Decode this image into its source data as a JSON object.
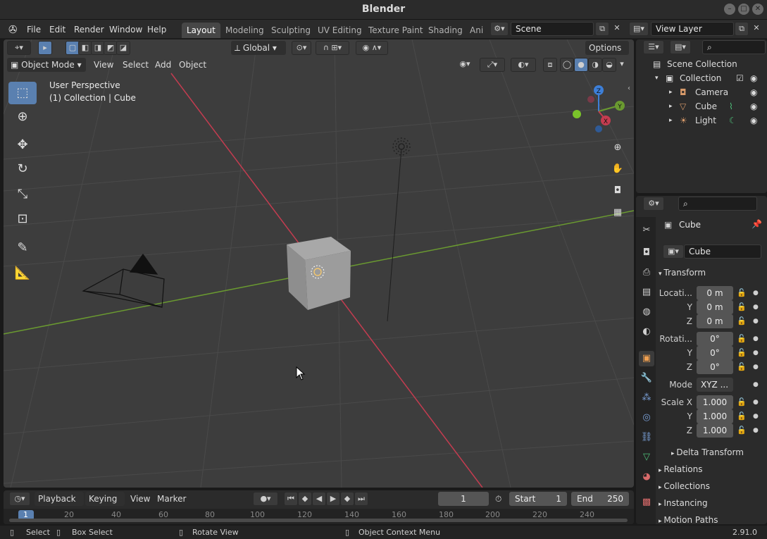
{
  "window": {
    "title": "Blender",
    "controls": [
      "–",
      "□",
      "✕"
    ]
  },
  "menubar": {
    "menus": [
      "File",
      "Edit",
      "Render",
      "Window",
      "Help"
    ],
    "workspace_tabs": [
      "Layout",
      "Modeling",
      "Sculpting",
      "UV Editing",
      "Texture Paint",
      "Shading",
      "Ani"
    ],
    "active_tab": "Layout",
    "scene": "Scene",
    "view_layer": "View Layer"
  },
  "viewport_header": {
    "transform_orientation": "Global",
    "options_label": "Options",
    "mode": "Object Mode",
    "menus": [
      "View",
      "Select",
      "Add",
      "Object"
    ]
  },
  "viewport": {
    "perspective_label": "User Perspective",
    "collection_label": "(1) Collection | Cube",
    "gizmo_axes": {
      "x": "X",
      "y": "Y",
      "z": "Z"
    }
  },
  "outliner": {
    "root": "Scene Collection",
    "collection": "Collection",
    "items": [
      "Camera",
      "Cube",
      "Light"
    ]
  },
  "properties": {
    "object_name": "Cube",
    "data_name": "Cube",
    "transform_title": "Transform",
    "location": {
      "label": "Locati...",
      "x": "0 m",
      "y": "0 m",
      "z": "0 m"
    },
    "rotation": {
      "label": "Rotati...",
      "x": "0°",
      "y": "0°",
      "z": "0°"
    },
    "mode_label": "Mode",
    "mode_value": "XYZ ...",
    "scale": {
      "label": "Scale X",
      "x": "1.000",
      "y": "1.000",
      "z": "1.000"
    },
    "axis_labels": {
      "y": "Y",
      "z": "Z"
    },
    "delta_transform": "Delta Transform",
    "sections": [
      "Relations",
      "Collections",
      "Instancing",
      "Motion Paths"
    ]
  },
  "timeline": {
    "menus": [
      "Playback",
      "Keying",
      "View",
      "Marker"
    ],
    "current_frame": "1",
    "start_label": "Start",
    "start_value": "1",
    "end_label": "End",
    "end_value": "250",
    "ruler_ticks": [
      "1",
      "20",
      "40",
      "60",
      "80",
      "100",
      "120",
      "140",
      "160",
      "180",
      "200",
      "220",
      "240"
    ]
  },
  "statusbar": {
    "items": [
      "Select",
      "Box Select",
      "Rotate View",
      "Object Context Menu"
    ],
    "version": "2.91.0"
  },
  "colors": {
    "accent": "#5a80b0",
    "x_axis": "#c43c50",
    "y_axis": "#6a9a30",
    "z_axis": "#3d7fd8"
  }
}
